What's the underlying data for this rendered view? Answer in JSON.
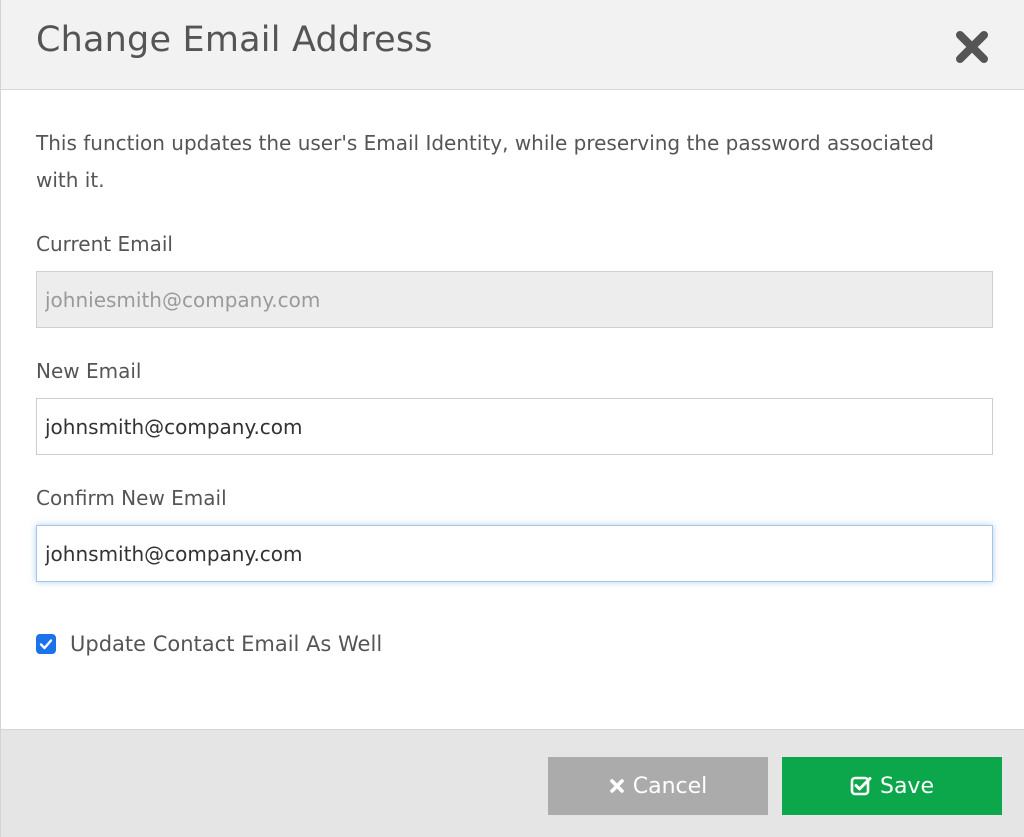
{
  "dialog": {
    "title": "Change Email Address",
    "description": "This function updates the user's Email Identity, while preserving the password associated with it."
  },
  "fields": {
    "current_email": {
      "label": "Current Email",
      "value": "johniesmith@company.com"
    },
    "new_email": {
      "label": "New Email",
      "value": "johnsmith@company.com"
    },
    "confirm_email": {
      "label": "Confirm New Email",
      "value": "johnsmith@company.com"
    }
  },
  "checkbox": {
    "label": "Update Contact Email As Well",
    "checked": true
  },
  "footer": {
    "cancel_label": "Cancel",
    "save_label": "Save"
  },
  "icons": {
    "close": "close-icon",
    "cancel": "x-icon",
    "save": "check-square-icon",
    "checkbox": "checkmark-icon"
  },
  "colors": {
    "save_button": "#0ca74a",
    "cancel_button": "#ababab",
    "checkbox": "#1a73e8",
    "header_bg": "#f2f2f2",
    "footer_bg": "#e5e5e5"
  }
}
